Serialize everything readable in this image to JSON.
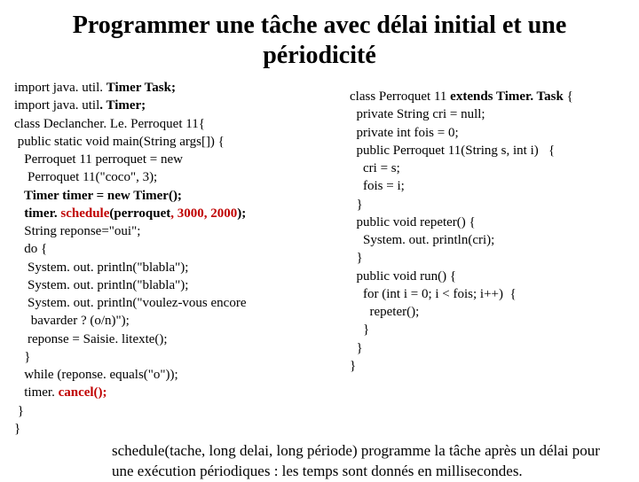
{
  "title": "Programmer une tâche avec délai initial et une périodicité",
  "left": {
    "l01a": "import java. util. ",
    "l01b": "Timer Task;",
    "l02a": "import java. util",
    "l02b": ". Timer;",
    "l03": "class Declancher. Le. Perroquet 11{",
    "l04": " public static void main(String args[]) {",
    "l05": "   Perroquet 11 perroquet = new",
    "l06": "    Perroquet 11(\"coco\", 3);",
    "l07": "   Timer timer = new Timer();",
    "l08a": "   timer. ",
    "l08b": "schedule",
    "l08c": "(perroquet",
    "l08d": ", 3000, 2000",
    "l08e": ");",
    "l09": "   String reponse=\"oui\";",
    "l10": "   do {",
    "l11": "    System. out. println(\"blabla\");",
    "l12": "    System. out. println(\"blabla\");",
    "l13": "    System. out. println(\"voulez-vous encore",
    "l14": "     bavarder ? (o/n)\");",
    "l15": "    reponse = Saisie. litexte();",
    "l16": "   }",
    "l17": "   while (reponse. equals(\"o\"));",
    "l18a": "   timer. ",
    "l18b": "cancel();",
    "l19": " }",
    "l20": "}"
  },
  "right": {
    "l01a": "class Perroquet 11 ",
    "l01b": "extends Timer. Task",
    "l01c": " {",
    "l02": "  private String cri = null;",
    "l03": "  private int fois = 0;",
    "l04": "  public Perroquet 11(String s, int i)   {",
    "l05": "    cri = s;",
    "l06": "    fois = i;",
    "l07": "  }",
    "l08": "  public void repeter() {",
    "l09": "    System. out. println(cri);",
    "l10": "  }",
    "l11": "  public void run() {",
    "l12": "    for (int i = 0; i < fois; i++)  {",
    "l13": "      repeter();",
    "l14": "    }",
    "l15": "  }",
    "l16": "}"
  },
  "footnote": "schedule(tache, long delai, long période) programme la tâche après un délai pour une exécution périodiques : les temps sont donnés en millisecondes."
}
